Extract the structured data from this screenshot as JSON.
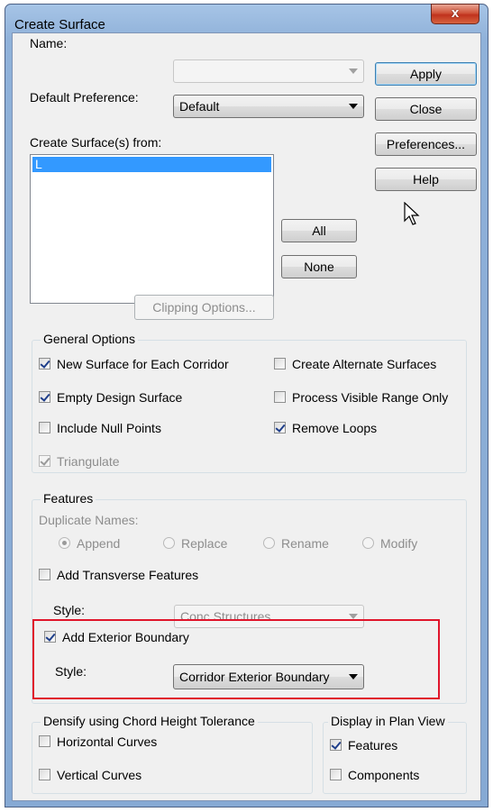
{
  "window": {
    "title": "Create Surface",
    "close_glyph": "x"
  },
  "fields": {
    "name_label": "Name:",
    "name_value": "",
    "default_pref_label": "Default Preference:",
    "default_pref_value": "Default",
    "create_from_label": "Create Surface(s) from:",
    "list_items": [
      "L"
    ]
  },
  "buttons": {
    "apply": "Apply",
    "close": "Close",
    "preferences": "Preferences...",
    "help": "Help",
    "all": "All",
    "none": "None",
    "clipping": "Clipping Options..."
  },
  "general": {
    "title": "General Options",
    "new_surface": {
      "label": "New Surface for Each Corridor",
      "checked": true
    },
    "create_alternate": {
      "label": "Create Alternate Surfaces",
      "checked": false
    },
    "empty_design": {
      "label": "Empty Design Surface",
      "checked": true
    },
    "process_visible": {
      "label": "Process Visible Range Only",
      "checked": false
    },
    "include_null": {
      "label": "Include Null Points",
      "checked": false
    },
    "remove_loops": {
      "label": "Remove Loops",
      "checked": true
    },
    "triangulate": {
      "label": "Triangulate",
      "checked": true
    }
  },
  "features": {
    "title": "Features",
    "duplicate_names_label": "Duplicate Names:",
    "append": "Append",
    "replace": "Replace",
    "rename": "Rename",
    "modify": "Modify",
    "selected_duplicate": "Append",
    "add_transverse": {
      "label": "Add Transverse Features",
      "checked": false
    },
    "style_label_1": "Style:",
    "style_value_1": "Conc Structures",
    "add_exterior": {
      "label": "Add Exterior Boundary",
      "checked": true
    },
    "style_label_2": "Style:",
    "style_value_2": "Corridor Exterior Boundary"
  },
  "densify": {
    "title": "Densify using Chord Height Tolerance",
    "horizontal": {
      "label": "Horizontal Curves",
      "checked": false
    },
    "vertical": {
      "label": "Vertical Curves",
      "checked": false
    }
  },
  "display": {
    "title": "Display in Plan View",
    "features": {
      "label": "Features",
      "checked": true
    },
    "components": {
      "label": "Components",
      "checked": false
    }
  },
  "colors": {
    "highlight": "#e0152b",
    "selection": "#3399ff",
    "title_bar": "#8fb1d9"
  }
}
